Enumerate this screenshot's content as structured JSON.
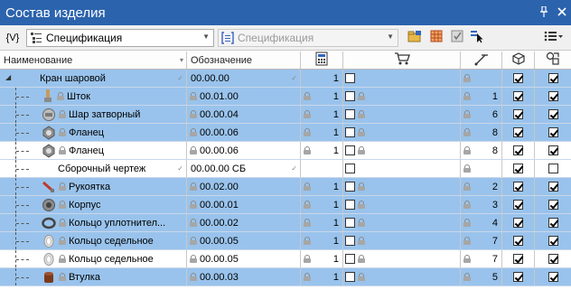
{
  "window": {
    "title": "Состав изделия"
  },
  "toolbar": {
    "variables_label": "{V}",
    "view_combo_value": "Спецификация",
    "doc_combo_value": "Спецификация"
  },
  "columns": {
    "name": "Наименование",
    "designation": "Обозначение"
  },
  "rows": [
    {
      "name": "Кран шаровой",
      "designation": "00.00.00",
      "qty": "1",
      "pos": "",
      "v1": true,
      "v2": true,
      "selected": true,
      "level": 0,
      "icon": "assembly",
      "locks": false,
      "buy_check": false
    },
    {
      "name": "Шток",
      "designation": "00.01.00",
      "qty": "1",
      "pos": "1",
      "v1": true,
      "v2": true,
      "selected": true,
      "level": 1,
      "icon": "stem-part-icon",
      "locks": true,
      "buy_check": false
    },
    {
      "name": "Шар затворный",
      "designation": "00.00.04",
      "qty": "1",
      "pos": "6",
      "v1": true,
      "v2": true,
      "selected": true,
      "level": 1,
      "icon": "ball-part-icon",
      "locks": true,
      "buy_check": false
    },
    {
      "name": "Фланец",
      "designation": "00.00.06",
      "qty": "1",
      "pos": "8",
      "v1": true,
      "v2": true,
      "selected": true,
      "level": 1,
      "icon": "flange-part-icon",
      "locks": true,
      "buy_check": false
    },
    {
      "name": "Фланец",
      "designation": "00.00.06",
      "qty": "1",
      "pos": "8",
      "v1": true,
      "v2": true,
      "selected": false,
      "level": 1,
      "icon": "flange-part-icon",
      "locks": true,
      "buy_check": false
    },
    {
      "name": "Сборочный чертеж",
      "designation": "00.00.00 СБ",
      "qty": "",
      "pos": "",
      "v1": true,
      "v2": false,
      "selected": false,
      "level": 1,
      "icon": "",
      "locks": false,
      "buy_check": false
    },
    {
      "name": "Рукоятка",
      "designation": "00.02.00",
      "qty": "1",
      "pos": "2",
      "v1": true,
      "v2": true,
      "selected": true,
      "level": 1,
      "icon": "handle-part-icon",
      "locks": true,
      "buy_check": false
    },
    {
      "name": "Корпус",
      "designation": "00.00.01",
      "qty": "1",
      "pos": "3",
      "v1": true,
      "v2": true,
      "selected": true,
      "level": 1,
      "icon": "body-part-icon",
      "locks": true,
      "buy_check": false
    },
    {
      "name": "Кольцо уплотнител...",
      "designation": "00.00.02",
      "qty": "1",
      "pos": "4",
      "v1": true,
      "v2": true,
      "selected": true,
      "level": 1,
      "icon": "ring-part-icon",
      "locks": true,
      "buy_check": false
    },
    {
      "name": "Кольцо седельное",
      "designation": "00.00.05",
      "qty": "1",
      "pos": "7",
      "v1": true,
      "v2": true,
      "selected": true,
      "level": 1,
      "icon": "seat-ring-part-icon",
      "locks": true,
      "buy_check": false
    },
    {
      "name": "Кольцо седельное",
      "designation": "00.00.05",
      "qty": "1",
      "pos": "7",
      "v1": true,
      "v2": true,
      "selected": false,
      "level": 1,
      "icon": "seat-ring-part-icon",
      "locks": true,
      "buy_check": false
    },
    {
      "name": "Втулка",
      "designation": "00.00.03",
      "qty": "1",
      "pos": "5",
      "v1": true,
      "v2": true,
      "selected": true,
      "level": 1,
      "icon": "bushing-part-icon",
      "locks": true,
      "buy_check": false
    }
  ],
  "colors": {
    "title_bg": "#2b63ad",
    "selection": "#99c3ec"
  }
}
